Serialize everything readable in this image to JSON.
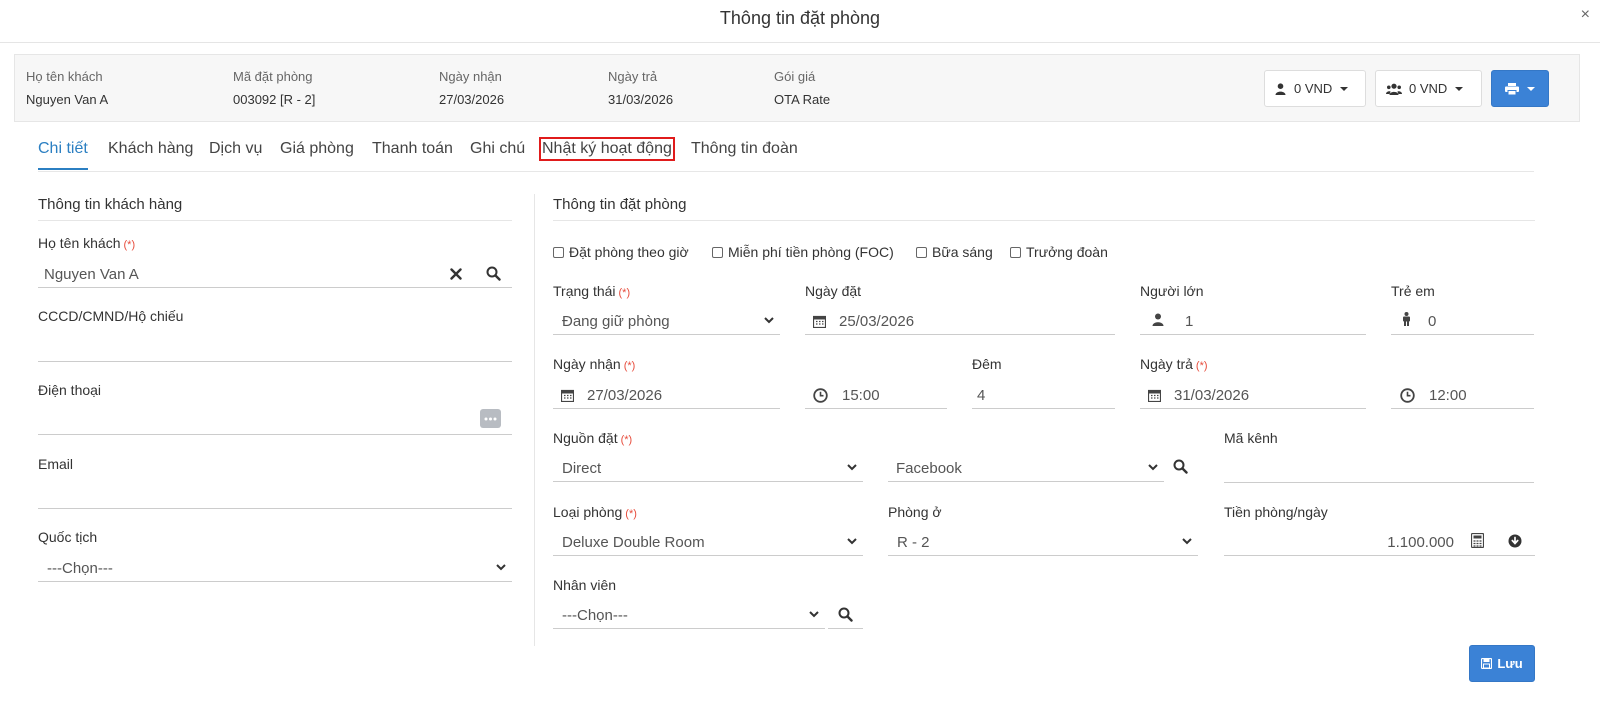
{
  "modal": {
    "title": "Thông tin đặt phòng",
    "close": "×"
  },
  "summary": {
    "guest_label": "Họ tên khách",
    "guest_value": "Nguyen Van A",
    "code_label": "Mã đặt phòng",
    "code_value": "003092 [R - 2]",
    "checkin_label": "Ngày nhận",
    "checkin_value": "27/03/2026",
    "checkout_label": "Ngày trả",
    "checkout_value": "31/03/2026",
    "rate_label": "Gói giá",
    "rate_value": "OTA Rate",
    "btn_person_amount": "0 VND",
    "btn_group_amount": "0 VND"
  },
  "tabs": [
    "Chi tiết",
    "Khách hàng",
    "Dịch vụ",
    "Giá phòng",
    "Thanh toán",
    "Ghi chú",
    "Nhật ký hoạt động",
    "Thông tin đoàn"
  ],
  "active_tab": "Chi tiết",
  "highlighted_tab": "Nhật ký hoạt động",
  "customer": {
    "section_title": "Thông tin khách hàng",
    "name_label": "Họ tên khách",
    "required": "(*)",
    "name_value": "Nguyen Van A",
    "id_label": "CCCD/CMND/Hộ chiếu",
    "id_value": "",
    "phone_label": "Điện thoại",
    "phone_value": "",
    "email_label": "Email",
    "email_value": "",
    "nationality_label": "Quốc tịch",
    "nationality_value": "---Chọn---"
  },
  "booking": {
    "section_title": "Thông tin đặt phòng",
    "checkboxes": [
      {
        "label": "Đặt phòng theo giờ",
        "checked": false
      },
      {
        "label": "Miễn phí tiền phòng (FOC)",
        "checked": false
      },
      {
        "label": "Bữa sáng",
        "checked": false
      },
      {
        "label": "Trưởng đoàn",
        "checked": false
      }
    ],
    "status_label": "Trạng thái",
    "status_value": "Đang giữ phòng",
    "booked_date_label": "Ngày đặt",
    "booked_date_value": "25/03/2026",
    "adults_label": "Người lớn",
    "adults_value": "1",
    "children_label": "Trẻ em",
    "children_value": "0",
    "checkin_label": "Ngày nhận",
    "checkin_date": "27/03/2026",
    "checkin_time": "15:00",
    "nights_label": "Đêm",
    "nights_value": "4",
    "checkout_label": "Ngày trả",
    "checkout_date": "31/03/2026",
    "checkout_time": "12:00",
    "source_label": "Nguồn đặt",
    "source_value": "Direct",
    "source_detail_value": "Facebook",
    "channel_code_label": "Mã kênh",
    "channel_code_value": "",
    "room_type_label": "Loại phòng",
    "room_type_value": "Deluxe Double Room",
    "room_label": "Phòng ở",
    "room_value": "R - 2",
    "rate_label": "Tiền phòng/ngày",
    "rate_value": "1.100.000",
    "staff_label": "Nhân viên",
    "staff_value": "---Chọn---",
    "required": "(*)"
  },
  "save_label": "Lưu",
  "colors": {
    "primary": "#3b82d6",
    "active_tab": "#2b7fc2",
    "required": "#e74c3c",
    "highlight_box": "#e01b1b"
  }
}
